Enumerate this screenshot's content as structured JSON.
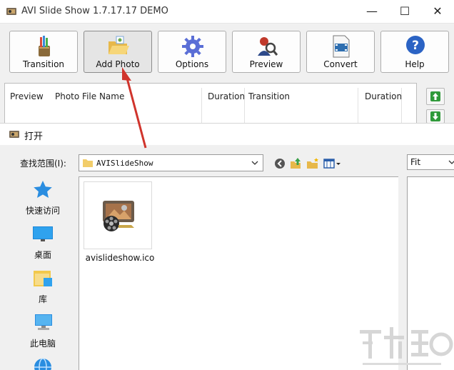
{
  "window": {
    "title": "AVI Slide Show 1.7.17.17 DEMO",
    "minimize": "—",
    "maximize": "☐",
    "close": "✕"
  },
  "toolbar": {
    "buttons": [
      {
        "label": "Transition",
        "icon": "brushes-icon"
      },
      {
        "label": "Add Photo",
        "icon": "folder-open-icon"
      },
      {
        "label": "Options",
        "icon": "gear-icon"
      },
      {
        "label": "Preview",
        "icon": "magnifier-person-icon"
      },
      {
        "label": "Convert",
        "icon": "film-doc-icon"
      },
      {
        "label": "Help",
        "icon": "help-icon"
      }
    ]
  },
  "list": {
    "columns": [
      "Preview",
      "Photo File Name",
      "Duration",
      "Transition",
      "Duration"
    ]
  },
  "dialog": {
    "title": "打开",
    "look_in_label": "查找范围(I):",
    "look_in_value": "AVISlideShow",
    "fit_value": "Fit",
    "places": [
      {
        "label": "快速访问",
        "icon": "star-icon"
      },
      {
        "label": "桌面",
        "icon": "desktop-icon"
      },
      {
        "label": "库",
        "icon": "library-icon"
      },
      {
        "label": "此电脑",
        "icon": "computer-icon"
      },
      {
        "label": "",
        "icon": "network-icon"
      }
    ],
    "files": [
      {
        "name": "avislideshow.ico",
        "icon": "film-reel-icon"
      }
    ]
  },
  "colors": {
    "accent_arrow": "#d0342c",
    "toolbar_bg": "#f0f0f0"
  }
}
